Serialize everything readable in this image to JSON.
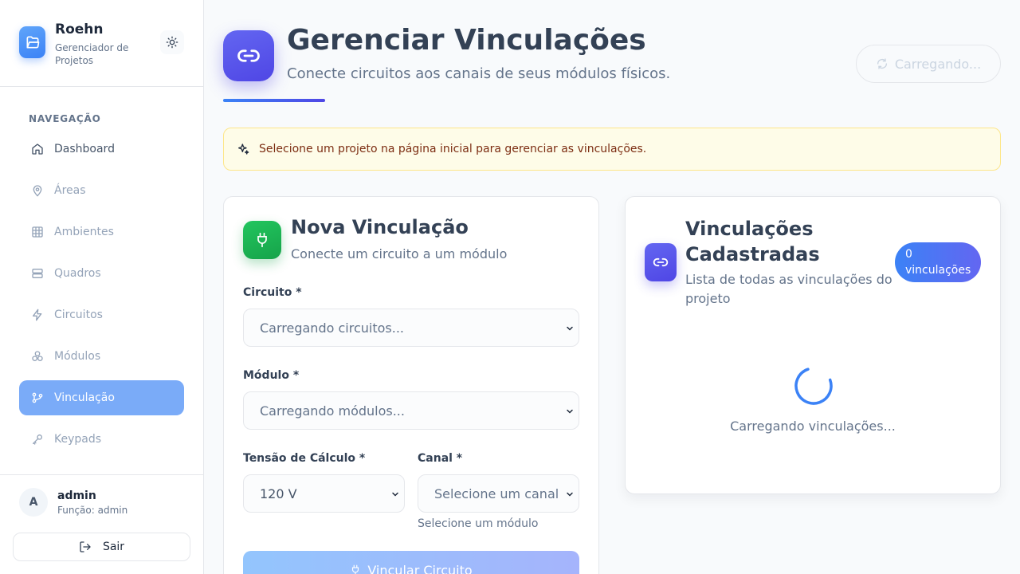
{
  "sidebar": {
    "brand_title": "Roehn",
    "brand_subtitle": "Gerenciador de Projetos",
    "nav_heading": "NAVEGAÇÃO",
    "items": [
      {
        "label": "Dashboard",
        "icon": "home-icon"
      },
      {
        "label": "Áreas",
        "icon": "map-pin-icon"
      },
      {
        "label": "Ambientes",
        "icon": "grid-icon"
      },
      {
        "label": "Quadros",
        "icon": "server-icon"
      },
      {
        "label": "Circuitos",
        "icon": "zap-icon"
      },
      {
        "label": "Módulos",
        "icon": "boxes-icon"
      },
      {
        "label": "Vinculação",
        "icon": "git-branch-icon",
        "active": true
      },
      {
        "label": "Keypads",
        "icon": "keypad-icon"
      }
    ],
    "user": {
      "initial": "A",
      "name": "admin",
      "role": "Função: admin"
    },
    "logout_label": "Sair"
  },
  "header": {
    "title": "Gerenciar Vinculações",
    "subtitle": "Conecte circuitos aos canais de seus módulos físicos.",
    "loading_label": "Carregando..."
  },
  "alert": {
    "text": "Selecione um projeto na página inicial para gerenciar as vinculações."
  },
  "form": {
    "title": "Nova Vinculação",
    "subtitle": "Conecte um circuito a um módulo",
    "circuito_label": "Circuito *",
    "circuito_value": "Carregando circuitos...",
    "modulo_label": "Módulo *",
    "modulo_value": "Carregando módulos...",
    "tensao_label": "Tensão de Cálculo *",
    "tensao_value": "120 V",
    "canal_label": "Canal *",
    "canal_value": "Selecione um canal",
    "canal_helper": "Selecione um módulo",
    "submit_label": "Vincular Circuito"
  },
  "list": {
    "title": "Vinculações Cadastradas",
    "subtitle": "Lista de todas as vinculações do projeto",
    "badge": "0 vinculações",
    "loading_text": "Carregando vinculações..."
  },
  "colors": {
    "accent": "#3b82f6",
    "active_nav": "#7aabf8",
    "indigo": "#4f46e5",
    "green": "#16a34a",
    "alert_bg": "#fefce8"
  }
}
